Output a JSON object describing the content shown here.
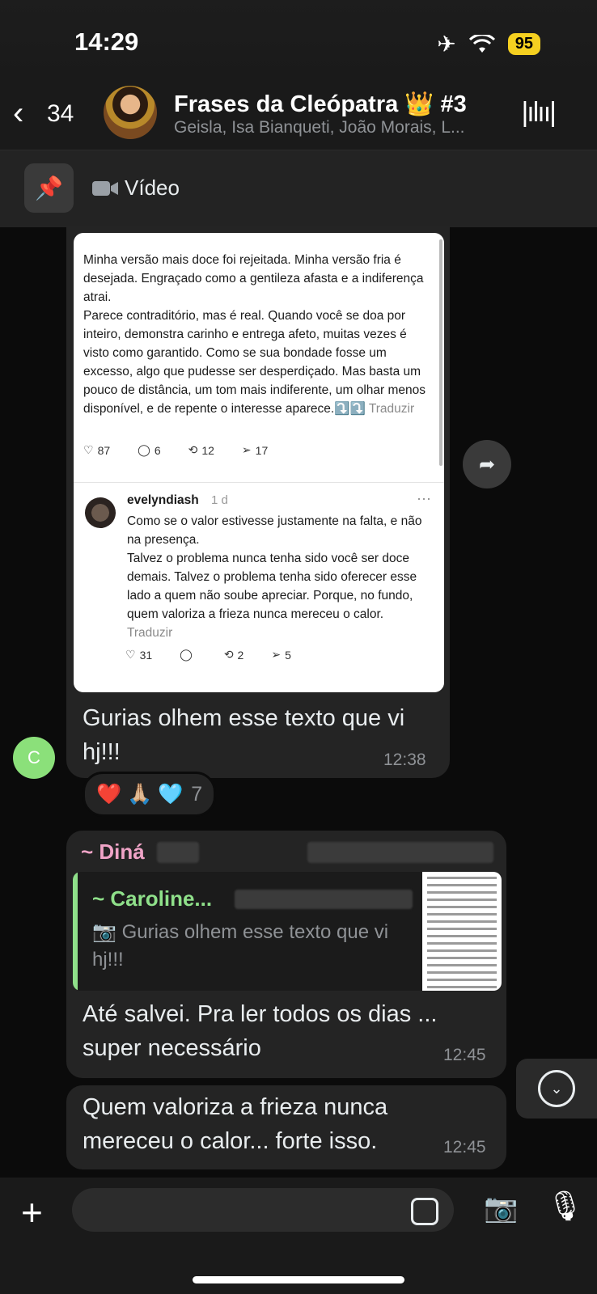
{
  "status": {
    "time": "14:29",
    "battery": "95"
  },
  "header": {
    "back_count": "34",
    "title": "Frases da Cleópatra 👑 #3",
    "subtitle": "Geisla, Isa Bianqueti, João Morais, L..."
  },
  "pinned": {
    "label": "Vídeo"
  },
  "messages": [
    {
      "screenshot": {
        "post_text": "Minha versão mais doce foi rejeitada. Minha versão fria é desejada. Engraçado como a gentileza afasta e a indiferença atrai.\nParece contraditório, mas é real. Quando você se doa por inteiro, demonstra carinho e entrega afeto, muitas vezes é visto como garantido. Como se sua bondade fosse um excesso, algo que pudesse ser desperdiçado. Mas basta um pouco de distância, um tom mais indiferente, um olhar menos disponível, e de repente o interesse aparece.⤵️⤵️",
        "translate": "Traduzir",
        "post_stats": {
          "likes": "87",
          "comments": "6",
          "reposts": "12",
          "shares": "17"
        },
        "reply_user": "evelyndiash",
        "reply_time": "1 d",
        "reply_text": "Como se o valor estivesse justamente na falta, e não na presença.\nTalvez o problema nunca tenha sido você ser doce demais. Talvez o problema tenha sido oferecer esse lado a quem não soube apreciar. Porque, no fundo, quem valoriza a frieza nunca mereceu o calor.",
        "reply_stats": {
          "likes": "31",
          "comments": "",
          "reposts": "2",
          "shares": "5"
        }
      },
      "caption": "Gurias olhem esse texto que vi hj!!!",
      "time": "12:38",
      "sender_initial": "C",
      "reactions": {
        "emojis": "❤️ 🙏🏼 🩵",
        "count": "7"
      }
    },
    {
      "sender": "~ Diná",
      "quote_name": "~ Caroline...",
      "quote_text": "Gurias olhem esse texto que vi hj!!!",
      "text": "Até salvei. Pra ler todos os dias ... super necessário",
      "time": "12:45"
    },
    {
      "text": "Quem valoriza a frieza nunca mereceu o  calor... forte isso.",
      "time": "12:45"
    }
  ],
  "colors": {
    "accent_green": "#8fe08a",
    "sender_pink": "#f0a4c7",
    "battery": "#f5d020"
  }
}
